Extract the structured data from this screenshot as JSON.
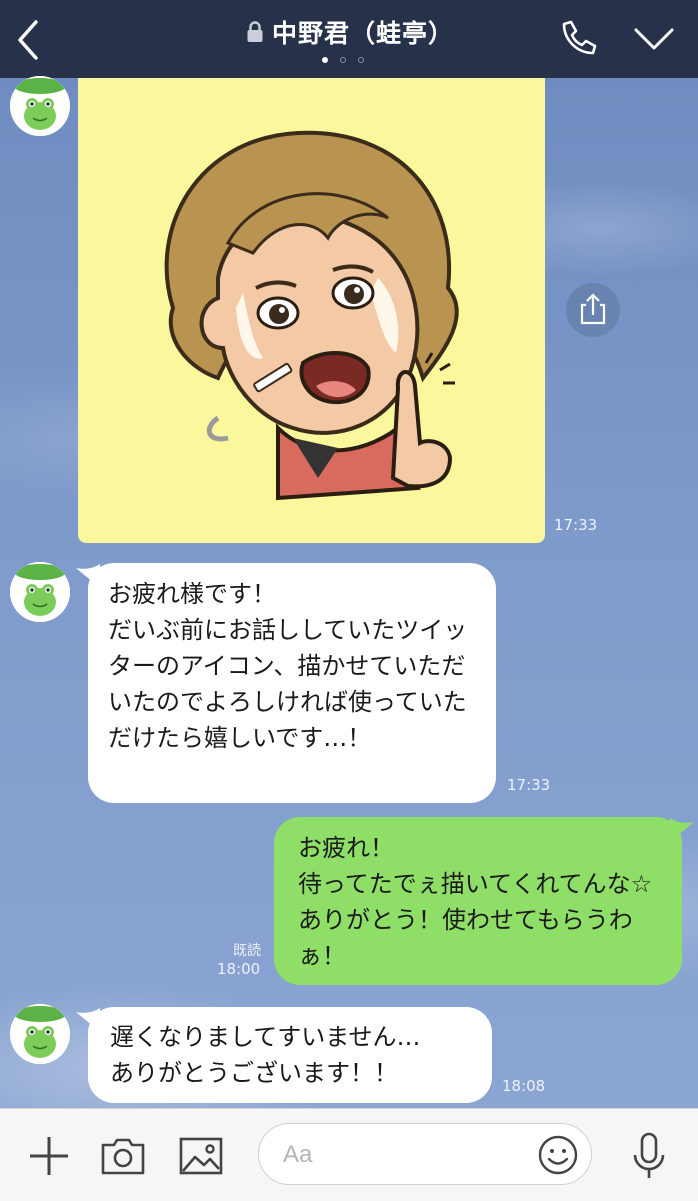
{
  "header": {
    "title": "中野君（蛙亭）",
    "back_icon": "chevron-left-icon",
    "lock_icon": "lock-icon",
    "call_icon": "phone-icon",
    "menu_icon": "chevron-down-icon",
    "page_count": 3,
    "active_page": 1
  },
  "messages": [
    {
      "type": "image",
      "sender": "other",
      "alt": "illustrated portrait sticker",
      "time": "17:33"
    },
    {
      "type": "text",
      "sender": "other",
      "text": "お疲れ様です！\nだいぶ前にお話ししていたツイッターのアイコン、描かせていただいたのでよろしければ使っていただけたら嬉しいです…！",
      "time": "17:33"
    },
    {
      "type": "text",
      "sender": "me",
      "text": "お疲れ！\n待ってたでぇ描いてくれてんな☆ありがとう！使わせてもらうわぁ！",
      "time": "18:00",
      "read": "既読"
    },
    {
      "type": "text",
      "sender": "other",
      "text": "遅くなりましてすいません…\nありがとうございます！！",
      "time": "18:08"
    }
  ],
  "input": {
    "placeholder": "Aa"
  },
  "toolbar": {
    "add_icon": "plus-icon",
    "camera_icon": "camera-icon",
    "image_icon": "image-icon",
    "emoji_icon": "smiley-icon",
    "mic_icon": "microphone-icon"
  },
  "colors": {
    "header_bg": "#27314a",
    "chat_bg": "#7b96c4",
    "my_bubble": "#8fde68",
    "other_bubble": "#ffffff",
    "image_bg": "#fbf79c"
  }
}
